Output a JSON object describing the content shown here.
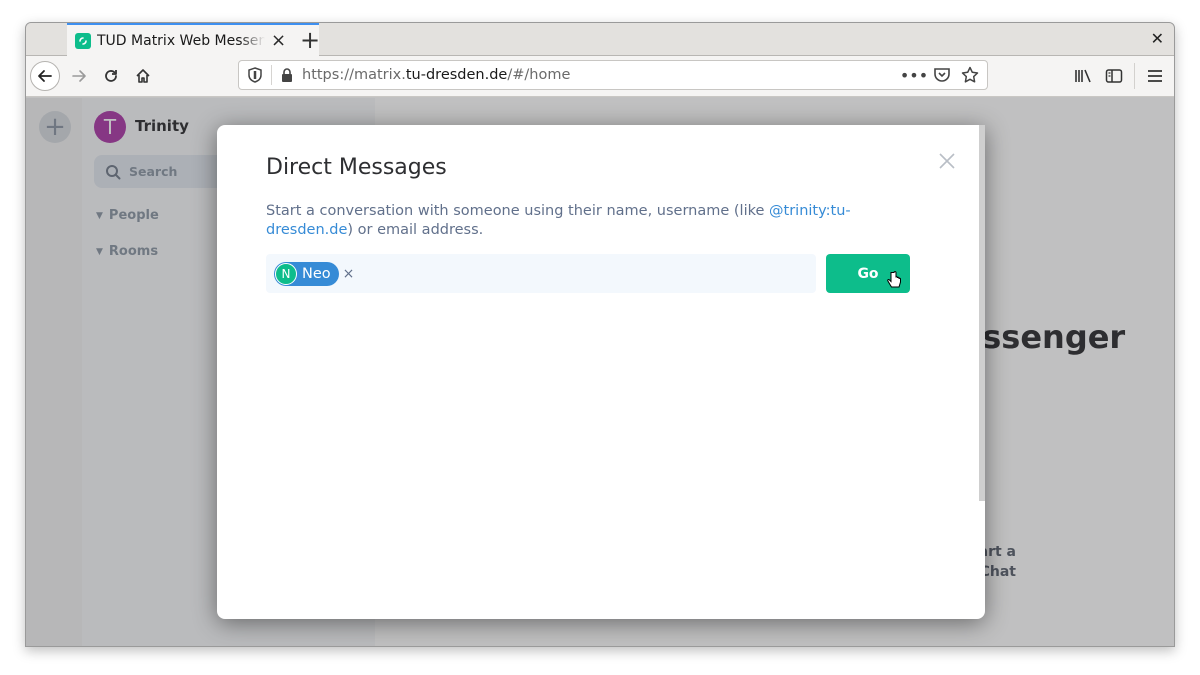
{
  "browser": {
    "tab_title": "TUD Matrix Web Messenger",
    "new_tab_label": "+",
    "url_prefix": "https://matrix.",
    "url_host": "tu-dresden.de",
    "url_path": "/#/home",
    "icons": {
      "back": "arrow-left-icon",
      "forward": "arrow-right-icon",
      "reload": "reload-icon",
      "home": "home-icon",
      "tracking": "shield-icon",
      "lock": "lock-icon",
      "more": "ellipsis-icon",
      "pocket": "pocket-icon",
      "bookmark": "star-icon",
      "library": "library-icon",
      "sidebar": "sidebar-icon",
      "menu": "hamburger-icon"
    }
  },
  "app": {
    "user": {
      "initial": "T",
      "name": "Trinity",
      "avatar_color": "#ac3ba8"
    },
    "search_placeholder": "Search",
    "sections": [
      "People",
      "Rooms"
    ],
    "welcome_title_partial": "TUD Matrix Web Messenger",
    "start_chat_label_line1": "Start a",
    "start_chat_label_line2": "Group Chat"
  },
  "dialog": {
    "title": "Direct Messages",
    "description_before": "Start a conversation with someone using their name, username (like ",
    "description_link": "@trinity:tu-dresden.de",
    "description_after": ") or email address.",
    "invitees": [
      {
        "initial": "N",
        "name": "Neo",
        "avatar_color": "#0dbd8b"
      }
    ],
    "go_label": "Go",
    "accent_color": "#0dbd8b",
    "link_color": "#368bd6"
  }
}
